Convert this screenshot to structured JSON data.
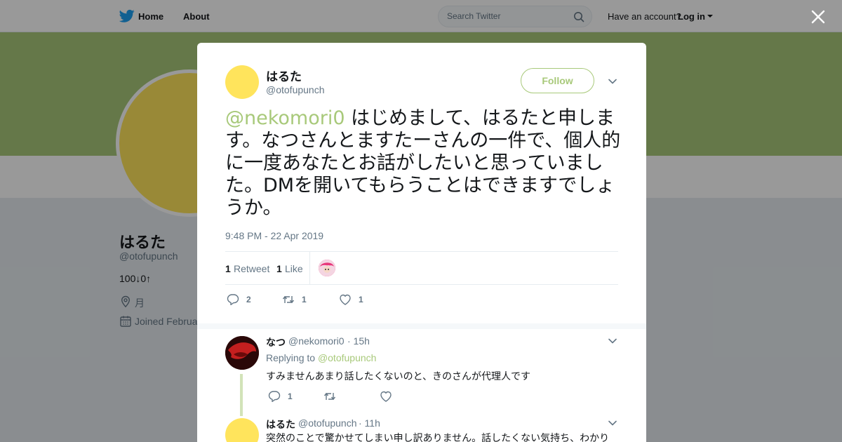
{
  "colors": {
    "accent": "#a8c97a",
    "avatar_yellow": "#ffe45c",
    "twitter_blue": "#1da1f2"
  },
  "nav": {
    "home_label": "Home",
    "about_label": "About",
    "search_placeholder": "Search Twitter",
    "have_account_label": "Have an account?",
    "login_label": "Log in"
  },
  "profile": {
    "name": "はるた",
    "handle": "@otofupunch",
    "bio": "100↓0↑",
    "location": "月",
    "joined": "Joined Februa"
  },
  "tweet": {
    "author_name": "はるた",
    "author_handle": "@otofupunch",
    "follow_label": "Follow",
    "mention": "@nekomori0",
    "text": " はじめまして、はるたと申します。なつさんとますたーさんの一件で、個人的に一度あなたとお話がしたいと思っていました。DMを開いてもらうことはできますでしょうか。",
    "timestamp": "9:48 PM - 22 Apr 2019",
    "retweet_count": "1",
    "retweet_label": "Retweet",
    "like_count": "1",
    "like_label": "Like",
    "actions": {
      "reply_count": "2",
      "retweet_count": "1",
      "like_count": "1"
    }
  },
  "replies": [
    {
      "name": "なつ",
      "handle": "@nekomori0",
      "time": "· 15h",
      "replying_label": "Replying to",
      "replying_handle": "@otofupunch",
      "text": "すみませんあまり話したくないのと、きのさんが代理人です",
      "reply_count": "1"
    },
    {
      "name": "はるた",
      "handle": "@otofupunch",
      "time": "· 11h",
      "text": "突然のことで驚かせてしまい申し訳ありません。話したくない気持ち、わかり"
    }
  ]
}
